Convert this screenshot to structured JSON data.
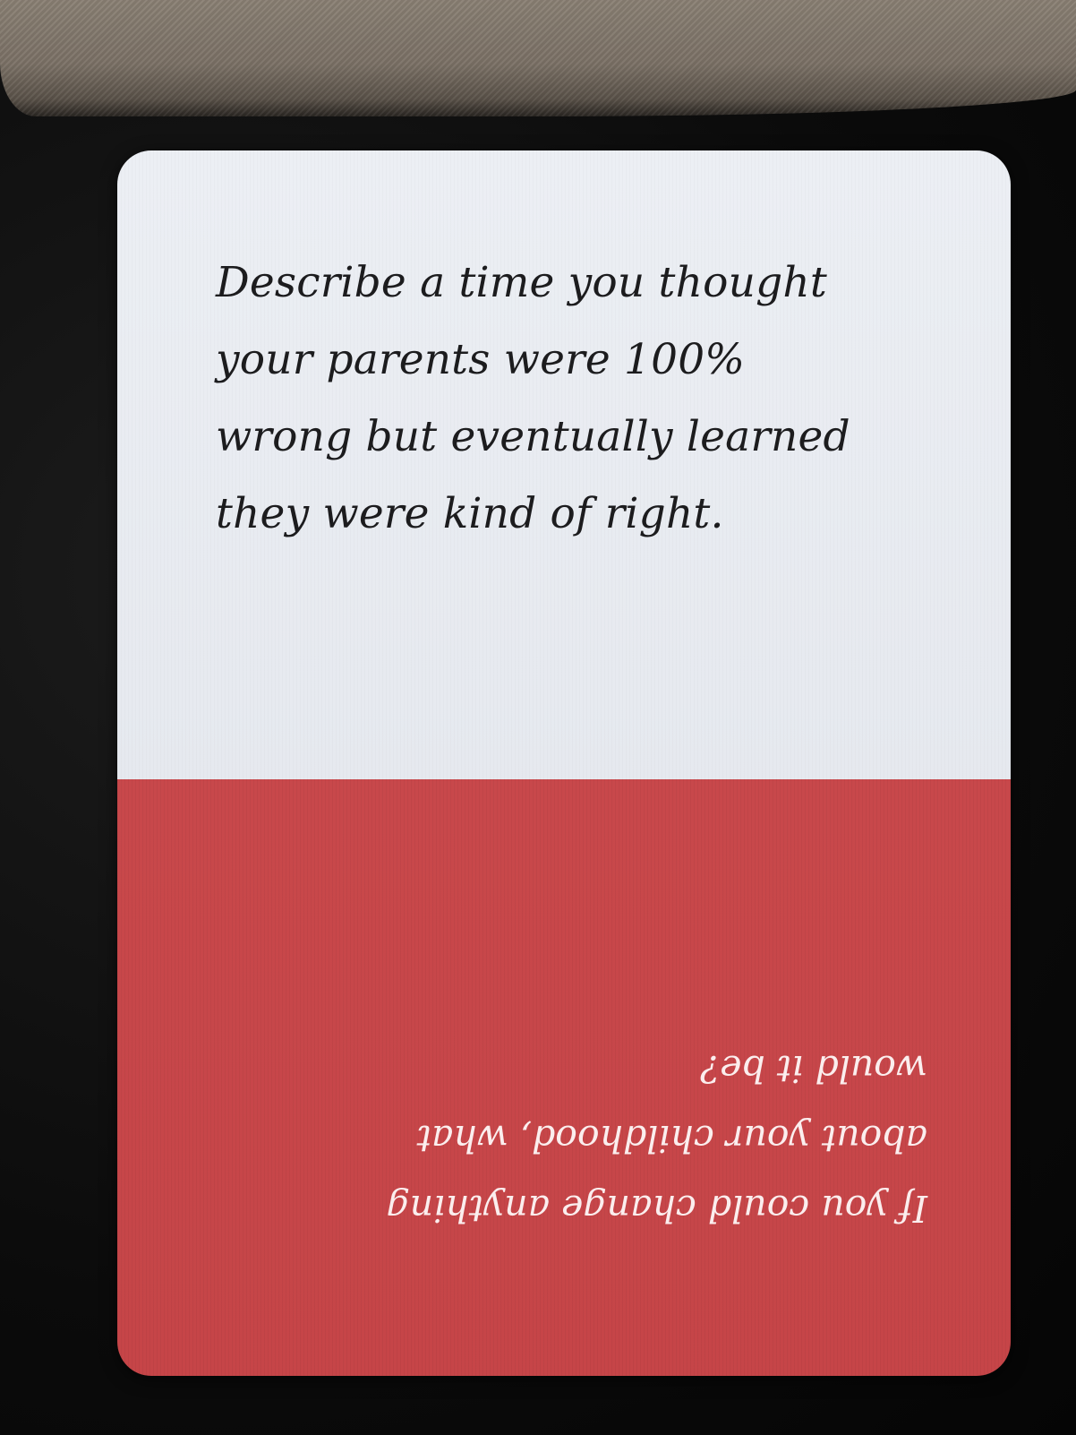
{
  "card": {
    "top_question_lines": [
      "Describe a time you thought",
      "your parents were 100%",
      "wrong but eventually learned",
      "they were kind of right."
    ],
    "bottom_question_lines": [
      "If you could change anything",
      "about your childhood, what",
      "would it be?"
    ],
    "bottom_text_orientation": "upside-down",
    "colors": {
      "top_half": "#e8ebf1",
      "bottom_half": "#c6474a",
      "top_text": "#1c1c1e",
      "bottom_text": "#fbeeee",
      "background": "#0d0d0d"
    }
  }
}
